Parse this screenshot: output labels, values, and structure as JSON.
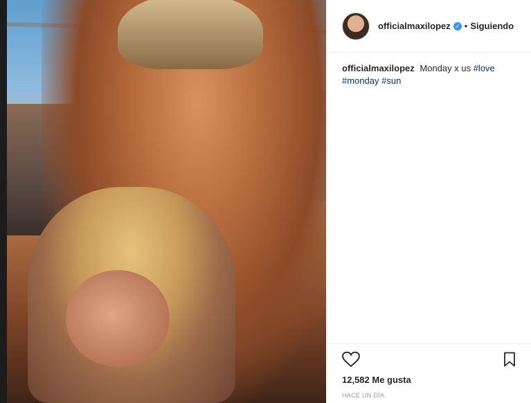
{
  "header": {
    "username": "officialmaxilopez",
    "verified_glyph": "✓",
    "separator": "•",
    "follow_status": "Siguiendo"
  },
  "caption": {
    "username": "officialmaxilopez",
    "text": "Monday x us",
    "hashtags": [
      "#love",
      "#monday",
      "#sun"
    ]
  },
  "actions": {
    "like_icon": "heart-icon",
    "save_icon": "bookmark-icon",
    "likes_text": "12,582 Me gusta",
    "timestamp": "HACE UN DÍA"
  },
  "colors": {
    "link": "#003569",
    "verified": "#3897f0",
    "text": "#262626",
    "muted": "#999999"
  }
}
